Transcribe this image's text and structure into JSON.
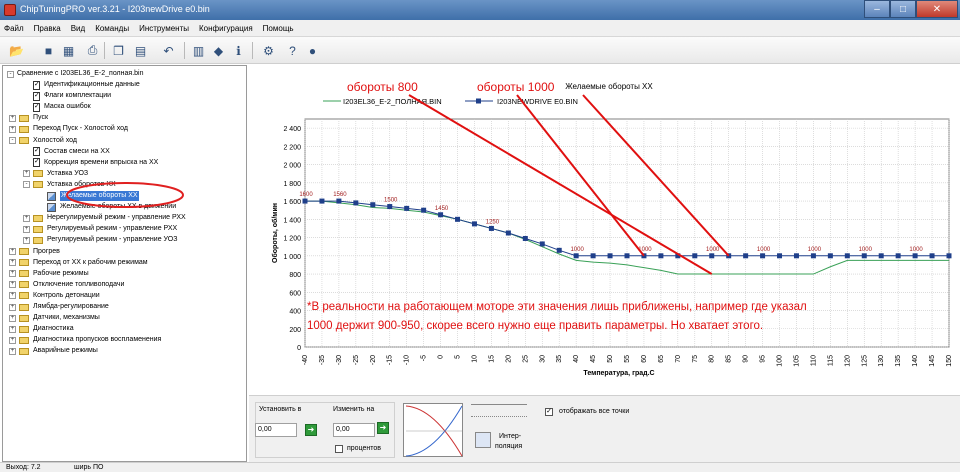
{
  "window": {
    "title": "ChipTuningPRO ver.3.21 - I203newDrive e0.bin",
    "minimize": "–",
    "maximize": "□",
    "close": "✕"
  },
  "menu": [
    "Файл",
    "Правка",
    "Вид",
    "Команды",
    "Инструменты",
    "Конфигурация",
    "Помощь"
  ],
  "toolbar_icons": [
    "open-icon",
    "save-icon",
    "save-all-icon",
    "print-icon",
    "copy-icon",
    "paste-icon",
    "undo-icon",
    "book-icon",
    "diamond-icon",
    "info-icon",
    "settings-icon",
    "help-icon"
  ],
  "tree": {
    "root": "Сравнение с I203EL36_E-2_полная.bin",
    "items": [
      {
        "label": "Идентификационные данные",
        "icon": "doc"
      },
      {
        "label": "Флаги комплектации",
        "icon": "doc"
      },
      {
        "label": "Маска ошибок",
        "icon": "doc"
      },
      {
        "label": "Пуск",
        "icon": "folder",
        "expander": "+"
      },
      {
        "label": "Переход Пуск - Холостой ход",
        "icon": "folder",
        "expander": "+"
      },
      {
        "label": "Холостой ход",
        "icon": "folder",
        "expander": "-"
      },
      {
        "label": "Состав смеси на ХХ",
        "icon": "doc"
      },
      {
        "label": "Коррекция времени впрыска на ХХ",
        "icon": "doc"
      },
      {
        "label": "Уставка УОЗ",
        "icon": "folder",
        "expander": "+"
      },
      {
        "label": "Уставка оборотов ХХ",
        "icon": "folder",
        "expander": "-"
      },
      {
        "label": "Желаемые обороты ХХ",
        "icon": "map",
        "selected": true
      },
      {
        "label": "Желаемые обороты ХХ в движении",
        "icon": "map"
      },
      {
        "label": "Нерегулируемый режим - управление РХХ",
        "icon": "folder",
        "expander": "+"
      },
      {
        "label": "Регулируемый режим - управление РХХ",
        "icon": "folder",
        "expander": "+"
      },
      {
        "label": "Регулируемый режим - управление УОЗ",
        "icon": "folder",
        "expander": "+"
      },
      {
        "label": "Прогрев",
        "icon": "folder",
        "expander": "+"
      },
      {
        "label": "Переход от ХХ к рабочим режимам",
        "icon": "folder",
        "expander": "+"
      },
      {
        "label": "Рабочие режимы",
        "icon": "folder",
        "expander": "+"
      },
      {
        "label": "Отключение топливоподачи",
        "icon": "folder",
        "expander": "+"
      },
      {
        "label": "Контроль детонации",
        "icon": "folder",
        "expander": "+"
      },
      {
        "label": "Лямбда-регулирование",
        "icon": "folder",
        "expander": "+"
      },
      {
        "label": "Датчики, механизмы",
        "icon": "folder",
        "expander": "+"
      },
      {
        "label": "Диагностика",
        "icon": "folder",
        "expander": "+"
      },
      {
        "label": "Диагностика пропусков воспламенения",
        "icon": "folder",
        "expander": "+"
      },
      {
        "label": "Аварийные режимы",
        "icon": "folder",
        "expander": "+"
      }
    ]
  },
  "chart_data": {
    "type": "line",
    "title": "Желаемые обороты ХХ",
    "xlabel": "Температура, град.С",
    "ylabel": "Обороты, об/мин",
    "x": [
      -40,
      -35,
      -30,
      -25,
      -20,
      -15,
      -10,
      -5,
      0,
      5,
      10,
      15,
      20,
      25,
      30,
      35,
      40,
      45,
      50,
      55,
      60,
      65,
      70,
      75,
      80,
      85,
      90,
      95,
      100,
      105,
      110,
      115,
      120,
      125,
      130,
      135,
      140,
      145,
      150
    ],
    "ylim": [
      0,
      2500
    ],
    "yticks": [
      0,
      200,
      400,
      600,
      800,
      1000,
      1200,
      1400,
      1600,
      1800,
      2000,
      2200,
      2400
    ],
    "grid": true,
    "legend_position": "top-center",
    "series": [
      {
        "name": "I203EL36_E-2_ПОЛНАЯ.BIN",
        "color": "#3aa157",
        "values": [
          1600,
          1600,
          1580,
          1560,
          1530,
          1520,
          1500,
          1480,
          1440,
          1400,
          1350,
          1300,
          1250,
          1180,
          1100,
          1020,
          950,
          930,
          920,
          900,
          870,
          840,
          800,
          800,
          800,
          800,
          800,
          800,
          800,
          800,
          800,
          880,
          950,
          950,
          950,
          950,
          950,
          950,
          950
        ]
      },
      {
        "name": "I203NEWDRIVE E0.BIN",
        "color": "#1f3f8a",
        "values": [
          1600,
          1600,
          1600,
          1580,
          1560,
          1540,
          1520,
          1500,
          1450,
          1400,
          1350,
          1300,
          1250,
          1190,
          1130,
          1060,
          1000,
          1000,
          1000,
          1000,
          1000,
          1000,
          1000,
          1000,
          1000,
          1000,
          1000,
          1000,
          1000,
          1000,
          1000,
          1000,
          1000,
          1000,
          1000,
          1000,
          1000,
          1000,
          1000
        ]
      }
    ],
    "point_labels": [
      {
        "x": -40,
        "text": "1600"
      },
      {
        "x": -30,
        "text": "1560"
      },
      {
        "x": -15,
        "text": "1500"
      },
      {
        "x": 0,
        "text": "1450"
      },
      {
        "x": 15,
        "text": "1250"
      },
      {
        "x": 40,
        "text": "1000"
      },
      {
        "x": 60,
        "text": "1000"
      },
      {
        "x": 80,
        "text": "1000"
      },
      {
        "x": 95,
        "text": "1000"
      },
      {
        "x": 110,
        "text": "1000"
      },
      {
        "x": 125,
        "text": "1000"
      },
      {
        "x": 140,
        "text": "1000"
      }
    ]
  },
  "annotations": {
    "label_800": "обороты 800",
    "label_1000": "обороты 1000",
    "note_line1": "*В реальности на работающем моторе эти значения лишь приближены, например где указал",
    "note_line2": "1000 держит 900-950, скорее всего нужно еще править параметры. Но хватает этого."
  },
  "bottom": {
    "set_to_label": "Установить в",
    "change_by_label": "Изменить на",
    "value1": "0,00",
    "value2": "0,00",
    "percent_label": "процентов",
    "interp_label_1": "Интер-",
    "interp_label_2": "поляция",
    "show_all_points": "отображать все точки"
  },
  "status": {
    "left": "Выход: 7.2",
    "mid": "ширь ПО"
  }
}
